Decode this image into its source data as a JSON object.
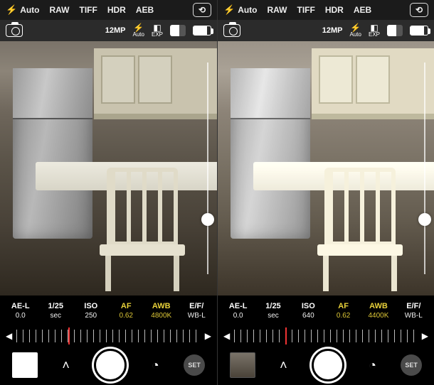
{
  "panes": [
    {
      "id": "left",
      "topbar": {
        "flash_mode": "Auto",
        "modes": [
          "RAW",
          "TIFF",
          "HDR",
          "AEB"
        ]
      },
      "secondbar": {
        "resolution": "12MP",
        "flash_label": "Auto",
        "exp_label": "EXP"
      },
      "exposure_handle_pct": 70,
      "params": [
        {
          "v1": "AE-L",
          "v2": "0.0",
          "hl": false
        },
        {
          "v1": "1/25",
          "v2": "sec",
          "hl": false
        },
        {
          "v1": "ISO",
          "v2": "250",
          "hl": false
        },
        {
          "v1": "AF",
          "v2": "0.62",
          "hl": true
        },
        {
          "v1": "AWB",
          "v2": "4800K",
          "hl": true
        },
        {
          "v1": "E/F/",
          "v2": "WB-L",
          "hl": false
        }
      ],
      "bottombar": {
        "set_label": "SET",
        "thumb_kind": "blank"
      }
    },
    {
      "id": "right",
      "topbar": {
        "flash_mode": "Auto",
        "modes": [
          "RAW",
          "TIFF",
          "HDR",
          "AEB"
        ]
      },
      "secondbar": {
        "resolution": "12MP",
        "flash_label": "Auto",
        "exp_label": "EXP"
      },
      "exposure_handle_pct": 70,
      "params": [
        {
          "v1": "AE-L",
          "v2": "0.0",
          "hl": false
        },
        {
          "v1": "1/25",
          "v2": "sec",
          "hl": false
        },
        {
          "v1": "ISO",
          "v2": "640",
          "hl": false
        },
        {
          "v1": "AF",
          "v2": "0.62",
          "hl": true
        },
        {
          "v1": "AWB",
          "v2": "4400K",
          "hl": true
        },
        {
          "v1": "E/F/",
          "v2": "WB-L",
          "hl": false
        }
      ],
      "bottombar": {
        "set_label": "SET",
        "thumb_kind": "photo"
      }
    }
  ]
}
